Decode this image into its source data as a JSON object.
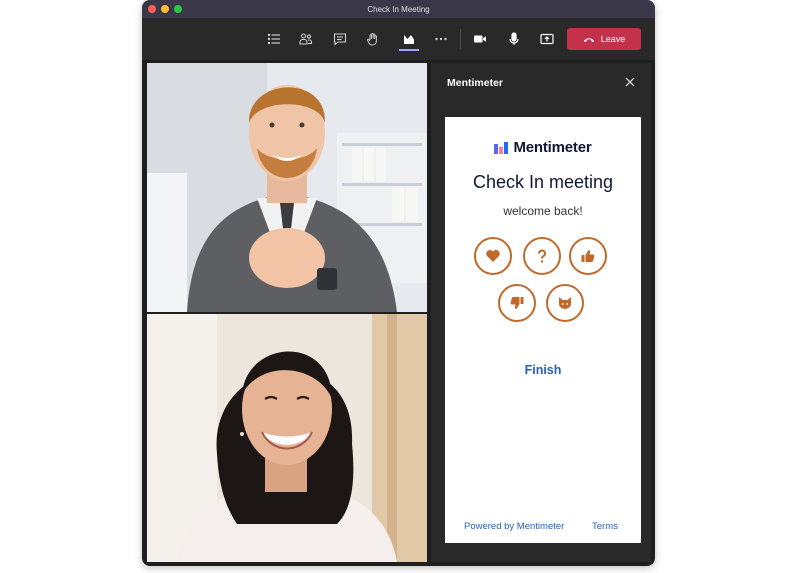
{
  "window": {
    "title": "Check In Meeting"
  },
  "toolbar": {
    "icons": [
      "list-icon",
      "people-icon",
      "chat-icon",
      "raise-hand-icon",
      "mentimeter-app-icon",
      "more-icon",
      "camera-icon",
      "microphone-icon",
      "share-screen-icon"
    ],
    "leave_label": "Leave",
    "leave_color": "#c4314b"
  },
  "panel": {
    "title": "Mentimeter",
    "card": {
      "brand": "Mentimeter",
      "title": "Check In meeting",
      "subtitle": "welcome back!",
      "reactions": [
        "heart-icon",
        "question-icon",
        "thumbs-up-icon",
        "thumbs-down-icon",
        "cat-icon"
      ],
      "reaction_color": "#c1692a",
      "finish_label": "Finish",
      "footer": {
        "powered_by": "Powered by Mentimeter",
        "terms": "Terms"
      }
    }
  }
}
